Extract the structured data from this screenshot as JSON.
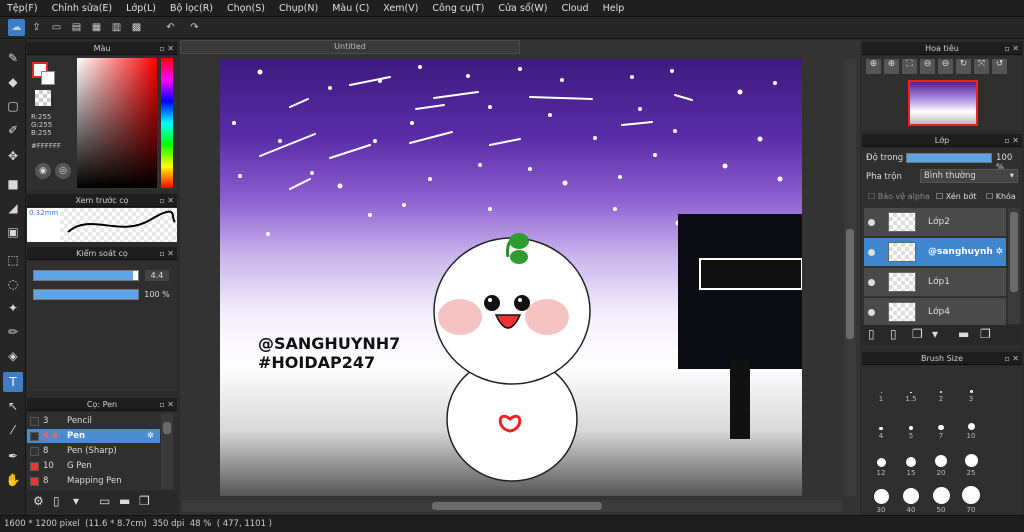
{
  "menu": [
    "Tệp(F)",
    "Chỉnh sửa(E)",
    "Lớp(L)",
    "Bộ lọc(R)",
    "Chọn(S)",
    "Chụp(N)",
    "Màu (C)",
    "Xem(V)",
    "Công cụ(T)",
    "Cửa sổ(W)",
    "Cloud",
    "Help"
  ],
  "panels": {
    "color": "Màu",
    "brush_preview": "Xem trước cọ",
    "brush_control": "Kiểm soát cọ",
    "brush_list": "Cọ: Pen",
    "navigator": "Hoa tiêu",
    "layer": "Lớp",
    "brush_size": "Brush Size"
  },
  "color": {
    "r": "R:255",
    "g": "G:255",
    "b": "B:255",
    "hex": "#FFFFFF"
  },
  "brush_preview_size": "0.32mm",
  "brush_control": {
    "size": "4.4",
    "opacity": "100 %",
    "size_fill": 0.95,
    "opacity_fill": 1.0
  },
  "brushes": [
    {
      "n": "3",
      "name": "Pencil",
      "color": "#333"
    },
    {
      "n": "4.4",
      "name": "Pen",
      "color": "#333"
    },
    {
      "n": "8",
      "name": "Pen (Sharp)",
      "color": "#333"
    },
    {
      "n": "10",
      "name": "G Pen",
      "color": "#e33"
    },
    {
      "n": "8",
      "name": "Mapping Pen",
      "color": "#e33"
    }
  ],
  "canvas_tab": "Untitled",
  "art_text": {
    "line1": "@SANGHUYNH7",
    "line2": "#HOIDAP247"
  },
  "layer_props": {
    "opacity_label": "Độ trong",
    "opacity_val": "100 %",
    "blend_label": "Pha trộn",
    "blend_val": "Bình thường",
    "protect_alpha": "Bảo vệ alpha",
    "clip": "Xén bớt",
    "lock": "Khóa"
  },
  "layers": [
    "Lớp2",
    "@sanghuynh",
    "Lớp1",
    "Lớp4"
  ],
  "brush_sizes": [
    "1",
    "1.5",
    "2",
    "3",
    "4",
    "5",
    "7",
    "10",
    "12",
    "15",
    "20",
    "25",
    "30",
    "40",
    "50",
    "70"
  ],
  "status": "1600 * 1200 pixel  (11.6 * 8.7cm)  350 dpi  48 %  ( 477, 1101 )"
}
